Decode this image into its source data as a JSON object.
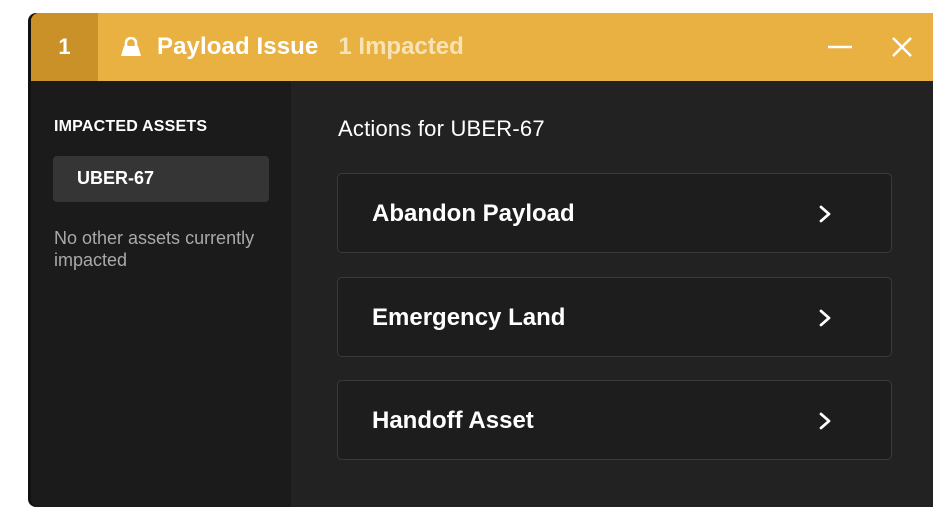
{
  "titlebar": {
    "badge": "1",
    "icon": "lock-icon",
    "title": "Payload Issue",
    "impacted": "1 Impacted",
    "minimize_icon": "minimize-icon",
    "close_icon": "close-icon"
  },
  "sidebar": {
    "heading": "IMPACTED ASSETS",
    "assets": [
      {
        "label": "UBER-67"
      }
    ],
    "note": "No other assets currently impacted"
  },
  "main": {
    "heading": "Actions for UBER-67",
    "actions": [
      {
        "label": "Abandon Payload",
        "icon": "chevron-right-icon"
      },
      {
        "label": "Emergency Land",
        "icon": "chevron-right-icon"
      },
      {
        "label": "Handoff Asset",
        "icon": "chevron-right-icon"
      }
    ]
  },
  "colors": {
    "titlebar_bg": "#e8b142",
    "badge_bg": "#c99128",
    "sidebar_bg": "#1b1b1b",
    "main_bg": "#222222",
    "card_bg": "#1d1d1d"
  }
}
